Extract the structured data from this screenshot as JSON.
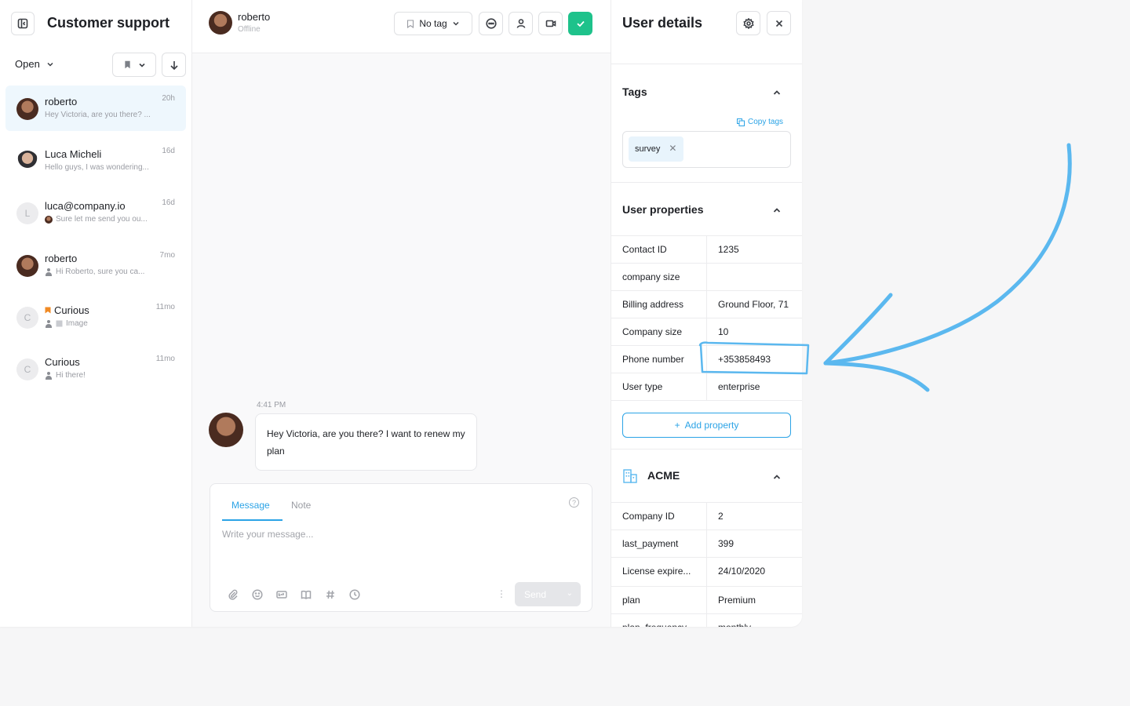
{
  "left": {
    "title": "Customer support",
    "filter": "Open",
    "conversations": [
      {
        "name": "roberto",
        "time": "20h",
        "preview": "Hey Victoria, are you there? ..."
      },
      {
        "name": "Luca Micheli",
        "time": "16d",
        "preview": "Hello guys, I was wondering..."
      },
      {
        "name": "luca@company.io",
        "time": "16d",
        "preview": "Sure let me send you ou...",
        "letter": "L"
      },
      {
        "name": "roberto",
        "time": "7mo",
        "preview": "Hi Roberto, sure you ca..."
      },
      {
        "name": "Curious",
        "time": "11mo",
        "preview": "Image",
        "letter": "C"
      },
      {
        "name": "Curious",
        "time": "11mo",
        "preview": "Hi there!",
        "letter": "C"
      }
    ]
  },
  "chat": {
    "user_name": "roberto",
    "user_status": "Offline",
    "tag_label": "No tag",
    "message_time": "4:41 PM",
    "message_text": "Hey Victoria, are you there? I want to renew my plan",
    "composer": {
      "tab_message": "Message",
      "tab_note": "Note",
      "placeholder": "Write your message...",
      "send_label": "Send"
    }
  },
  "details": {
    "title": "User details",
    "tags_title": "Tags",
    "copy_tags": "Copy tags",
    "tags": [
      "survey"
    ],
    "props_title": "User properties",
    "properties": [
      {
        "key": "Contact ID",
        "value": "1235"
      },
      {
        "key": "company size",
        "value": ""
      },
      {
        "key": "Billing address",
        "value": "Ground Floor, 71"
      },
      {
        "key": "Company size",
        "value": "10"
      },
      {
        "key": "Phone number",
        "value": "+353858493"
      },
      {
        "key": "User type",
        "value": "enterprise"
      }
    ],
    "add_property": "Add property",
    "company_title": "ACME",
    "company_properties": [
      {
        "key": "Company ID",
        "value": "2"
      },
      {
        "key": "last_payment",
        "value": "399"
      },
      {
        "key": "License expire...",
        "value": "24/10/2020"
      },
      {
        "key": "plan",
        "value": "Premium"
      },
      {
        "key": "plan_frequency",
        "value": "monthly"
      }
    ]
  },
  "colors": {
    "accent": "#2ba3e6",
    "success": "#1ec28b",
    "annotation": "#5bb8ef"
  }
}
